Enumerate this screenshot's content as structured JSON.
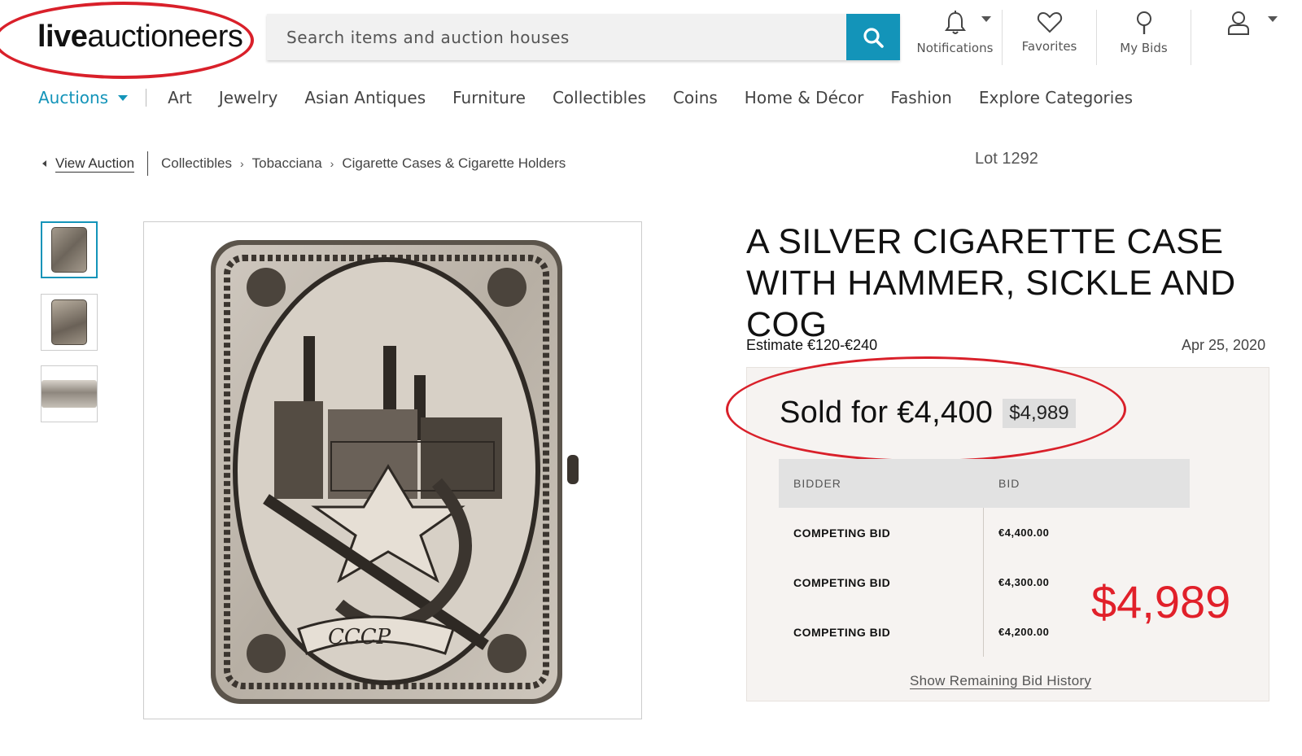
{
  "header": {
    "logo_live": "live",
    "logo_rest": "auctioneers",
    "search_placeholder": "Search items and auction houses",
    "nav": [
      {
        "label": "Notifications",
        "icon": "bell-icon"
      },
      {
        "label": "Favorites",
        "icon": "heart-icon"
      },
      {
        "label": "My Bids",
        "icon": "bid-paddle-icon"
      },
      {
        "label": "",
        "icon": "user-icon"
      }
    ]
  },
  "categories": {
    "auctions": "Auctions",
    "items": [
      "Art",
      "Jewelry",
      "Asian Antiques",
      "Furniture",
      "Collectibles",
      "Coins",
      "Home & Décor",
      "Fashion",
      "Explore Categories"
    ]
  },
  "breadcrumb": {
    "back": "View Auction",
    "path": [
      "Collectibles",
      "Tobacciana",
      "Cigarette Cases & Cigarette Holders"
    ]
  },
  "lot": "Lot 1292",
  "item": {
    "title": "A SILVER CIGARETTE CASE WITH HAMMER, SICKLE AND COG",
    "estimate": "Estimate €120-€240",
    "date": "Apr 25, 2020",
    "sold": "Sold for €4,400",
    "sold_usd": "$4,989",
    "engraving_text": "CCCP"
  },
  "bids": {
    "headers": [
      "BIDDER",
      "BID"
    ],
    "rows": [
      {
        "bidder": "COMPETING BID",
        "amount": "€4,400.00"
      },
      {
        "bidder": "COMPETING BID",
        "amount": "€4,300.00"
      },
      {
        "bidder": "COMPETING BID",
        "amount": "€4,200.00"
      }
    ],
    "history_link": "Show Remaining Bid History"
  },
  "annotation": {
    "big_usd": "$4,989"
  },
  "colors": {
    "accent": "#1394b9",
    "annotation_red": "#d9202a",
    "panel_bg": "#f6f3f1"
  }
}
